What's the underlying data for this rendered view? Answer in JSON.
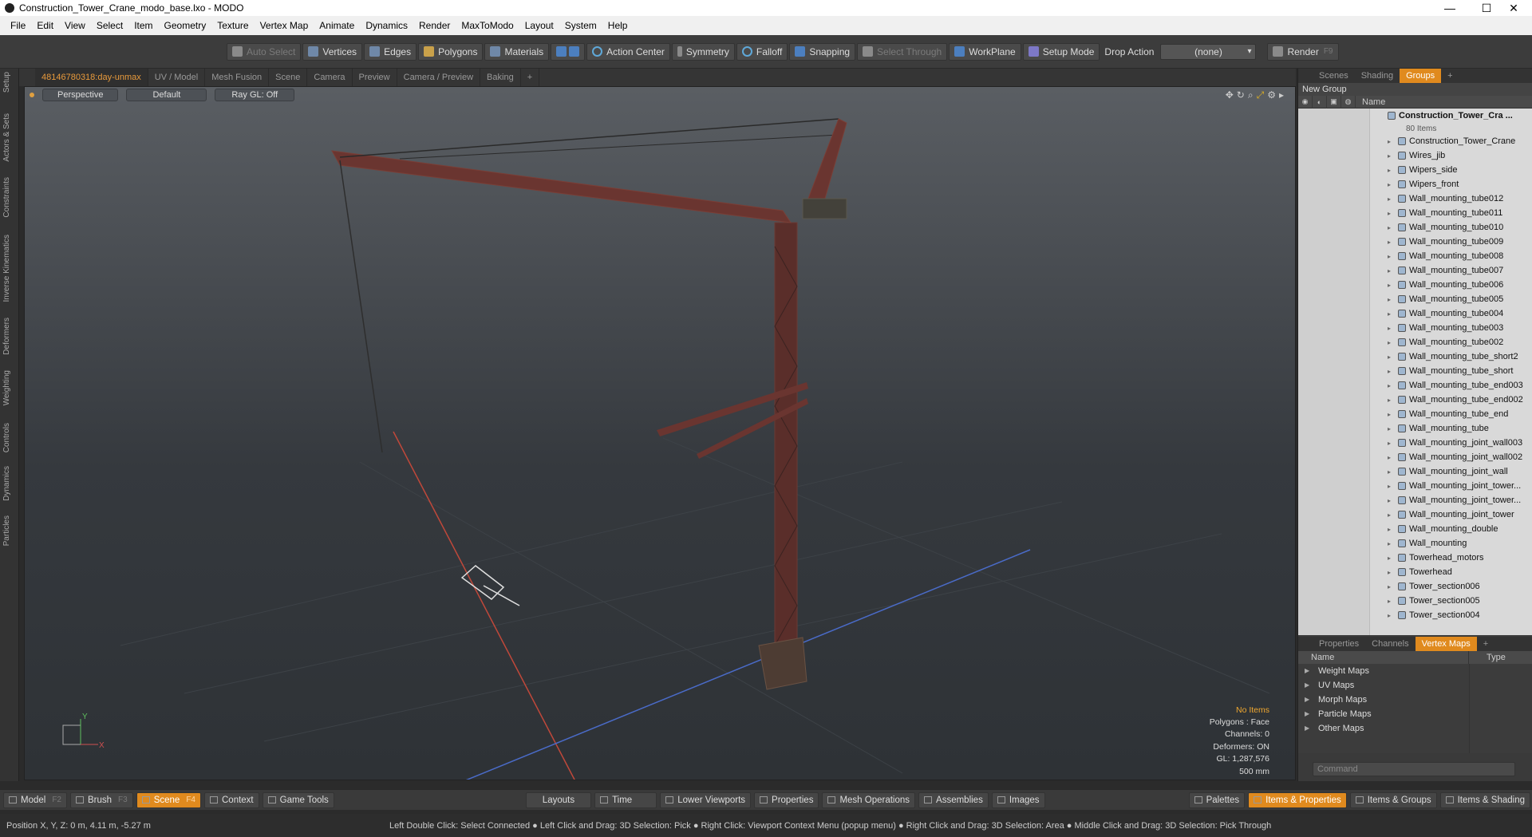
{
  "window": {
    "title": "Construction_Tower_Crane_modo_base.lxo - MODO",
    "minimize": "—",
    "maximize": "☐",
    "close": "✕"
  },
  "menu": [
    "File",
    "Edit",
    "View",
    "Select",
    "Item",
    "Geometry",
    "Texture",
    "Vertex Map",
    "Animate",
    "Dynamics",
    "Render",
    "MaxToModo",
    "Layout",
    "System",
    "Help"
  ],
  "toolbar": {
    "auto_select": "Auto Select",
    "vertices": "Vertices",
    "edges": "Edges",
    "polygons": "Polygons",
    "materials": "Materials",
    "action_center": "Action Center",
    "symmetry": "Symmetry",
    "falloff": "Falloff",
    "snapping": "Snapping",
    "select_through": "Select Through",
    "workplane": "WorkPlane",
    "setup_mode": "Setup Mode",
    "drop_action": "Drop Action",
    "drop_value": "(none)",
    "render": "Render",
    "render_key": "F9"
  },
  "left_tabs": [
    "Setup",
    "Actors & Sets",
    "Constraints",
    "Inverse Kinematics",
    "Deformers",
    "Weighting",
    "Controls",
    "Dynamics",
    "Particles"
  ],
  "viewport_tabs": [
    "48146780318:day-unmax",
    "UV / Model",
    "Mesh Fusion",
    "Scene",
    "Camera",
    "Preview",
    "Camera / Preview",
    "Baking",
    "+"
  ],
  "viewport": {
    "view": "Perspective",
    "shading": "Default",
    "raygl": "Ray GL: Off"
  },
  "info": {
    "items": "No Items",
    "polygons": "Polygons : Face",
    "channels": "Channels: 0",
    "deformers": "Deformers: ON",
    "gl": "GL: 1,287,576",
    "scale": "500 mm"
  },
  "right_tabs": [
    "Scenes",
    "Shading",
    "Groups",
    "+"
  ],
  "groups": {
    "new_group": "New Group",
    "name_col": "Name",
    "root": "Construction_Tower_Cra ...",
    "count": "80 Items",
    "items": [
      "Construction_Tower_Crane",
      "Wires_jib",
      "Wipers_side",
      "Wipers_front",
      "Wall_mounting_tube012",
      "Wall_mounting_tube011",
      "Wall_mounting_tube010",
      "Wall_mounting_tube009",
      "Wall_mounting_tube008",
      "Wall_mounting_tube007",
      "Wall_mounting_tube006",
      "Wall_mounting_tube005",
      "Wall_mounting_tube004",
      "Wall_mounting_tube003",
      "Wall_mounting_tube002",
      "Wall_mounting_tube_short2",
      "Wall_mounting_tube_short",
      "Wall_mounting_tube_end003",
      "Wall_mounting_tube_end002",
      "Wall_mounting_tube_end",
      "Wall_mounting_tube",
      "Wall_mounting_joint_wall003",
      "Wall_mounting_joint_wall002",
      "Wall_mounting_joint_wall",
      "Wall_mounting_joint_tower...",
      "Wall_mounting_joint_tower...",
      "Wall_mounting_joint_tower",
      "Wall_mounting_double",
      "Wall_mounting",
      "Towerhead_motors",
      "Towerhead",
      "Tower_section006",
      "Tower_section005",
      "Tower_section004"
    ]
  },
  "props_tabs": [
    "Properties",
    "Channels",
    "Vertex Maps",
    "+"
  ],
  "vmaps": {
    "name_col": "Name",
    "type_col": "Type",
    "items": [
      "Weight Maps",
      "UV Maps",
      "Morph Maps",
      "Particle Maps",
      "Other Maps"
    ]
  },
  "command_placeholder": "Command",
  "bottom": {
    "model": "Model",
    "model_key": "F2",
    "brush": "Brush",
    "brush_key": "F3",
    "scene": "Scene",
    "scene_key": "F4",
    "context": "Context",
    "game_tools": "Game Tools",
    "layouts": "Layouts",
    "time": "Time",
    "lower_viewports": "Lower Viewports",
    "properties": "Properties",
    "mesh_operations": "Mesh Operations",
    "assemblies": "Assemblies",
    "images": "Images",
    "palettes": "Palettes",
    "items_properties": "Items & Properties",
    "items_groups": "Items & Groups",
    "items_shading": "Items & Shading"
  },
  "status": {
    "position": "Position X, Y, Z:   0 m, 4.11 m, -5.27 m",
    "hints": "Left Double Click: Select Connected ● Left Click and Drag: 3D Selection: Pick ● Right Click: Viewport Context Menu (popup menu) ● Right Click and Drag: 3D Selection: Area ● Middle Click and Drag: 3D Selection: Pick Through"
  }
}
